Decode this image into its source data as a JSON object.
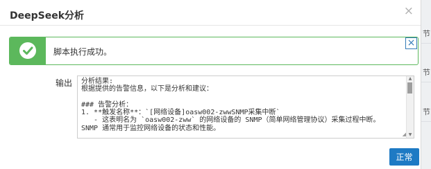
{
  "background": {
    "right_column_labels": [
      "节",
      "节",
      "节"
    ]
  },
  "dialog": {
    "title": "DeepSeek分析",
    "close_glyph": "×",
    "alert": {
      "message": "脚本执行成功。",
      "close_glyph": "×",
      "status_color": "#5cb85c"
    },
    "output": {
      "label": "输出",
      "content": "分析结果:\n根据提供的告警信息，以下是分析和建议：\n\n### 告警分析：\n1. **触发名称**：`[网络设备]oasw002-zwwSNMP采集中断`\n   - 这表明名为 `oasw002-zww` 的网络设备的 SNMP（简单网络管理协议）采集过程中断。\nSNMP 通常用于监控网络设备的状态和性能。"
    },
    "ok_button": "正常",
    "accent_color": "#1e7ac4"
  }
}
